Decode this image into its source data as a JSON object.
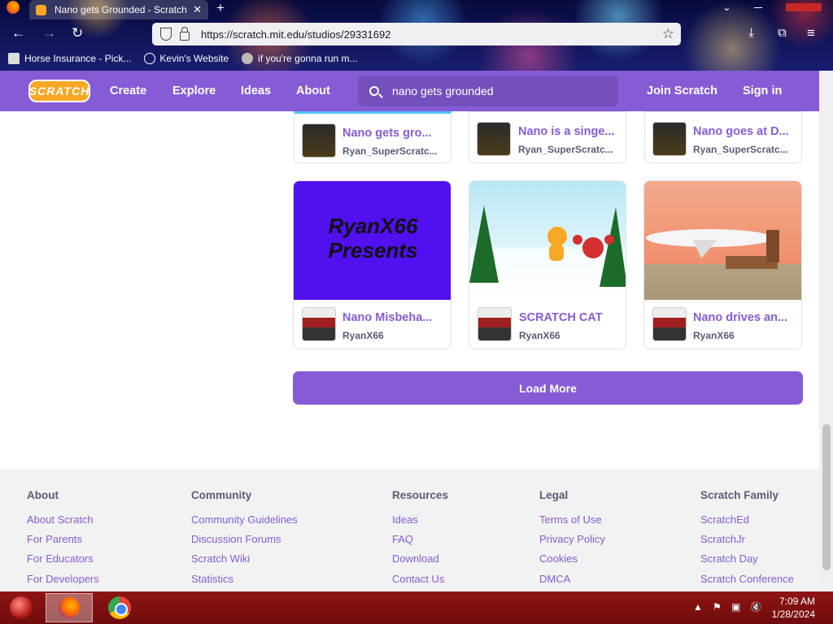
{
  "browser": {
    "tab_title": "Nano gets Grounded - Scratch",
    "new_tab": "+",
    "url": "https://scratch.mit.edu/studios/29331692",
    "bookmarks": [
      "Horse Insurance - Pick...",
      "Kevin's Website",
      "if you're gonna run m..."
    ]
  },
  "nav": {
    "logo": "SCRATCH",
    "links": [
      "Create",
      "Explore",
      "Ideas",
      "About"
    ],
    "search_value": "nano gets grounded",
    "join": "Join Scratch",
    "signin": "Sign in"
  },
  "projects": [
    {
      "title": "Nano gets gro...",
      "author": "Ryan_SuperScratc..."
    },
    {
      "title": "Nano is a singe...",
      "author": "Ryan_SuperScratc..."
    },
    {
      "title": "Nano goes at D...",
      "author": "Ryan_SuperScratc..."
    },
    {
      "title": "Nano Misbeha...",
      "author": "RyanX66",
      "thumb_text": "RyanX66 Presents"
    },
    {
      "title": "SCRATCH CAT",
      "author": "RyanX66"
    },
    {
      "title": "Nano drives an...",
      "author": "RyanX66"
    }
  ],
  "load_more": "Load More",
  "footer": {
    "columns": [
      {
        "heading": "About",
        "links": [
          "About Scratch",
          "For Parents",
          "For Educators",
          "For Developers"
        ]
      },
      {
        "heading": "Community",
        "links": [
          "Community Guidelines",
          "Discussion Forums",
          "Scratch Wiki",
          "Statistics"
        ]
      },
      {
        "heading": "Resources",
        "links": [
          "Ideas",
          "FAQ",
          "Download",
          "Contact Us"
        ]
      },
      {
        "heading": "Legal",
        "links": [
          "Terms of Use",
          "Privacy Policy",
          "Cookies",
          "DMCA"
        ]
      },
      {
        "heading": "Scratch Family",
        "links": [
          "ScratchEd",
          "ScratchJr",
          "Scratch Day",
          "Scratch Conference"
        ]
      }
    ]
  },
  "taskbar": {
    "time": "7:09 AM",
    "date": "1/28/2024"
  }
}
